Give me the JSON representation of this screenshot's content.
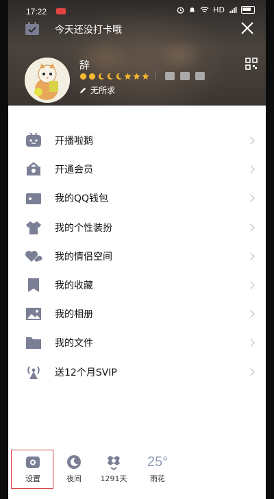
{
  "status_bar": {
    "time": "17:22",
    "network": "HD"
  },
  "checkin": {
    "text": "今天还没打卡哦"
  },
  "profile": {
    "nickname": "辞",
    "signature": "无所求"
  },
  "colors": {
    "icon": "#7b7f96",
    "accent_red": "#d43a3a",
    "weather": "#8e9ab4"
  },
  "menu": [
    {
      "label": "开播啦鹅",
      "icon": "tv-icon"
    },
    {
      "label": "开通会员",
      "icon": "vip-crown-icon"
    },
    {
      "label": "我的QQ钱包",
      "icon": "wallet-icon"
    },
    {
      "label": "我的个性装扮",
      "icon": "shirt-icon"
    },
    {
      "label": "我的情侣空间",
      "icon": "couple-hearts-icon"
    },
    {
      "label": "我的收藏",
      "icon": "bookmark-icon"
    },
    {
      "label": "我的相册",
      "icon": "photo-album-icon"
    },
    {
      "label": "我的文件",
      "icon": "folder-icon"
    },
    {
      "label": "送12个月SVIP",
      "icon": "broadcast-icon"
    }
  ],
  "bottom": {
    "settings": "设置",
    "night": "夜间",
    "days": "1291天",
    "weather_temp": "25°",
    "weather_place": "雨花"
  }
}
